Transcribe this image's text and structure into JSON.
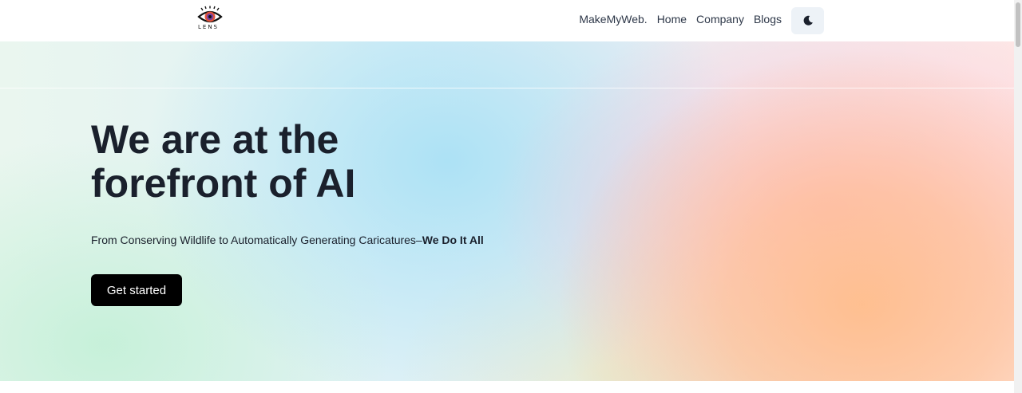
{
  "brand": {
    "logo_icon": "eye-logo-icon",
    "logo_text": "LENS"
  },
  "nav": {
    "items": [
      {
        "label": "MakeMyWeb."
      },
      {
        "label": "Home"
      },
      {
        "label": "Company"
      },
      {
        "label": "Blogs"
      }
    ],
    "theme_toggle_icon": "moon-icon"
  },
  "hero": {
    "title": "We are at the forefront of AI",
    "subtitle_lead": "From Conserving Wildlife to Automatically Generating Caricatures–",
    "subtitle_emphasis": "We Do It All",
    "cta_label": "Get started"
  },
  "colors": {
    "text": "#1a202c",
    "cta_bg": "#000000",
    "toggle_bg": "#edf2f7"
  }
}
